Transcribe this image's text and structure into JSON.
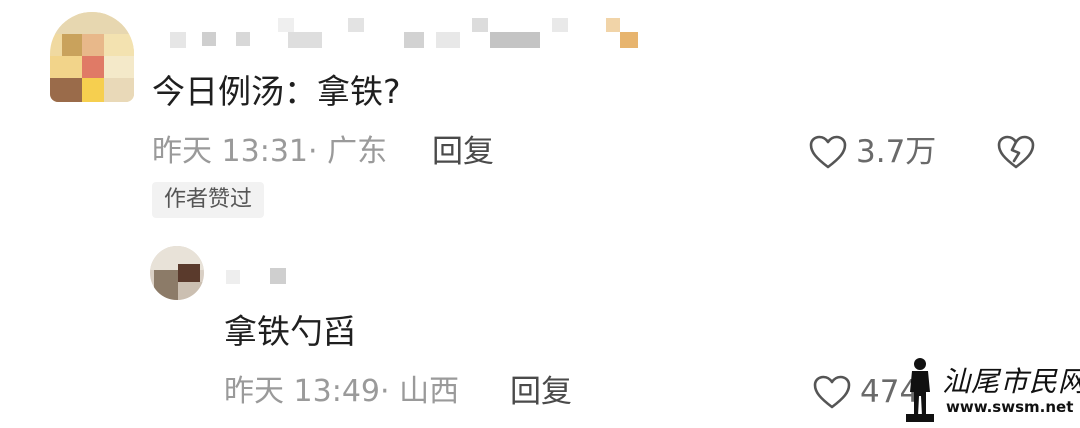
{
  "comment": {
    "text": "今日例汤：拿铁?",
    "time_location": "昨天 13:31· 广东",
    "reply_label": "回复",
    "like_count": "3.7万",
    "author_liked": "作者赞过",
    "like_icon": "heart-icon",
    "dislike_icon": "broken-heart-icon"
  },
  "reply": {
    "text": "拿铁勺舀",
    "time_location": "昨天 13:49· 山西",
    "reply_label": "回复",
    "like_count": "474",
    "like_icon": "heart-icon"
  },
  "watermark": {
    "title": "汕尾市民网",
    "url": "www.swsm.net"
  },
  "colors": {
    "text_primary": "#1f1f1f",
    "text_secondary": "#9a9a9a",
    "badge_bg": "#f2f2f2"
  }
}
